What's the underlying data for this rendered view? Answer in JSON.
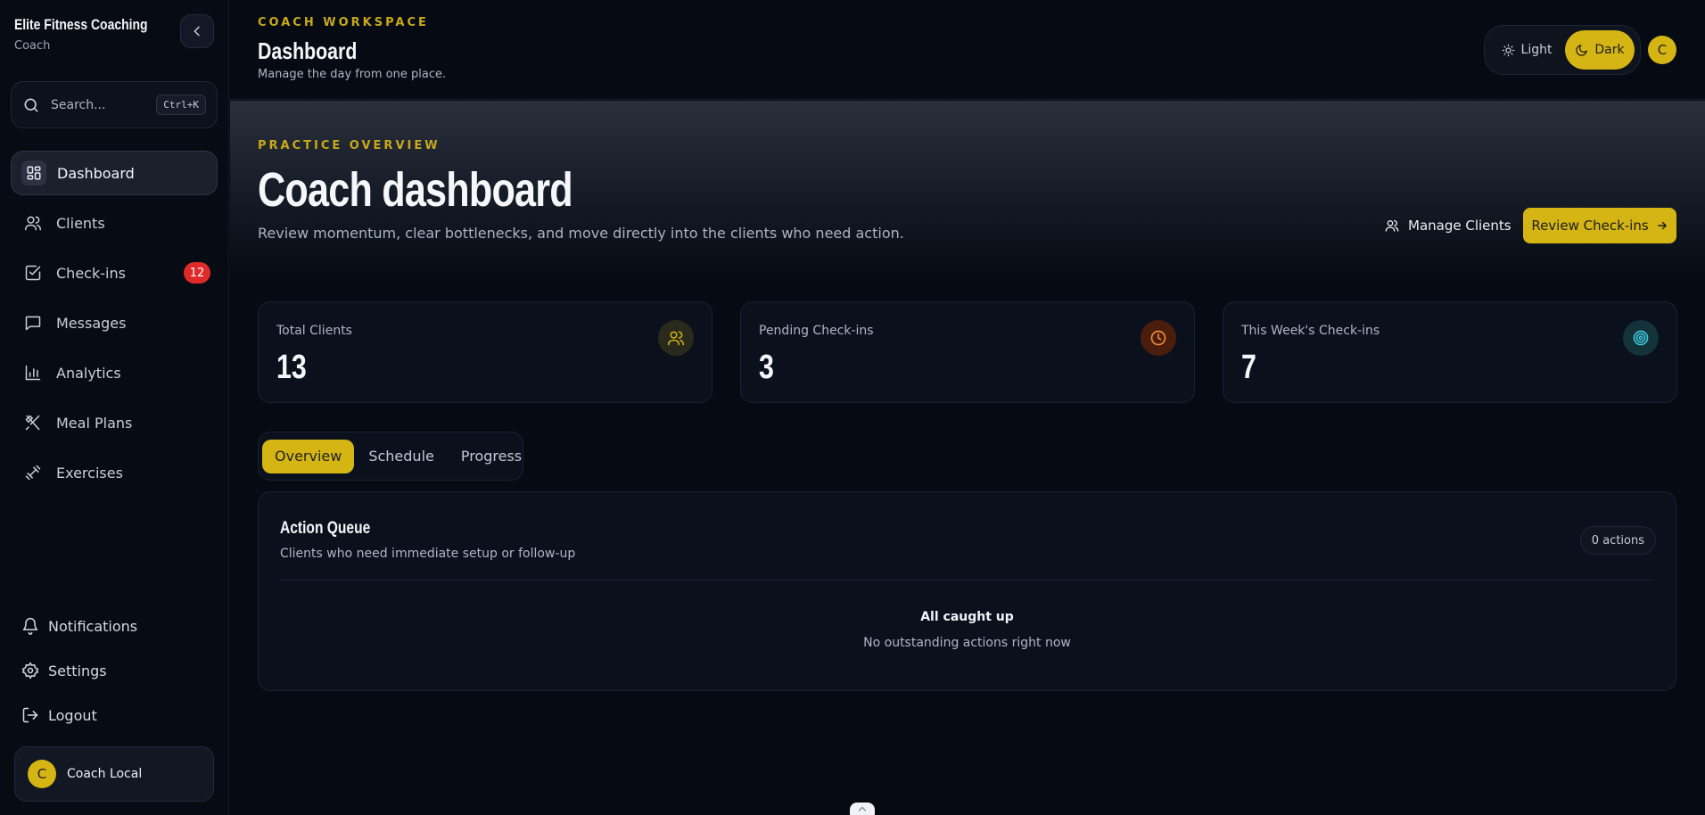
{
  "brand": {
    "name": "Elite Fitness Coaching",
    "role": "Coach"
  },
  "search": {
    "placeholder": "Search...",
    "shortcut": "Ctrl+K"
  },
  "sidebar": {
    "items": [
      {
        "label": "Dashboard",
        "icon": "grid-icon",
        "active": true
      },
      {
        "label": "Clients",
        "icon": "users-icon"
      },
      {
        "label": "Check-ins",
        "icon": "checkbox-icon",
        "badge": "12"
      },
      {
        "label": "Messages",
        "icon": "message-icon"
      },
      {
        "label": "Analytics",
        "icon": "bar-chart-icon"
      },
      {
        "label": "Meal Plans",
        "icon": "utensils-icon"
      },
      {
        "label": "Exercises",
        "icon": "dumbbell-icon"
      }
    ],
    "bottom": [
      {
        "label": "Notifications",
        "icon": "bell-icon"
      },
      {
        "label": "Settings",
        "icon": "gear-icon"
      },
      {
        "label": "Logout",
        "icon": "logout-icon"
      }
    ],
    "user": {
      "initial": "C",
      "name": "Coach Local"
    }
  },
  "header": {
    "eyebrow": "COACH WORKSPACE",
    "title": "Dashboard",
    "subtitle": "Manage the day from one place.",
    "theme": {
      "light": "Light",
      "dark": "Dark",
      "selected": "Dark"
    },
    "avatar_initial": "C"
  },
  "hero": {
    "eyebrow": "PRACTICE OVERVIEW",
    "title": "Coach dashboard",
    "subtitle": "Review momentum, clear bottlenecks, and move directly into the clients who need action.",
    "manage_label": "Manage Clients",
    "review_label": "Review Check-ins"
  },
  "stats": [
    {
      "label": "Total Clients",
      "value": "13",
      "icon": "users-icon",
      "color": "#d4b514"
    },
    {
      "label": "Pending Check-ins",
      "value": "3",
      "icon": "clock-icon",
      "color": "#f28c3a"
    },
    {
      "label": "This Week's Check-ins",
      "value": "7",
      "icon": "target-icon",
      "color": "#3fc6d9"
    }
  ],
  "tabs": [
    {
      "label": "Overview",
      "active": true
    },
    {
      "label": "Schedule"
    },
    {
      "label": "Progress"
    }
  ],
  "queue": {
    "title": "Action Queue",
    "subtitle": "Clients who need immediate setup or follow-up",
    "count": "0 actions",
    "empty_title": "All caught up",
    "empty_subtitle": "No outstanding actions right now"
  },
  "colors": {
    "accent": "#d4b514",
    "danger": "#e02a2a",
    "background": "#060a12"
  }
}
